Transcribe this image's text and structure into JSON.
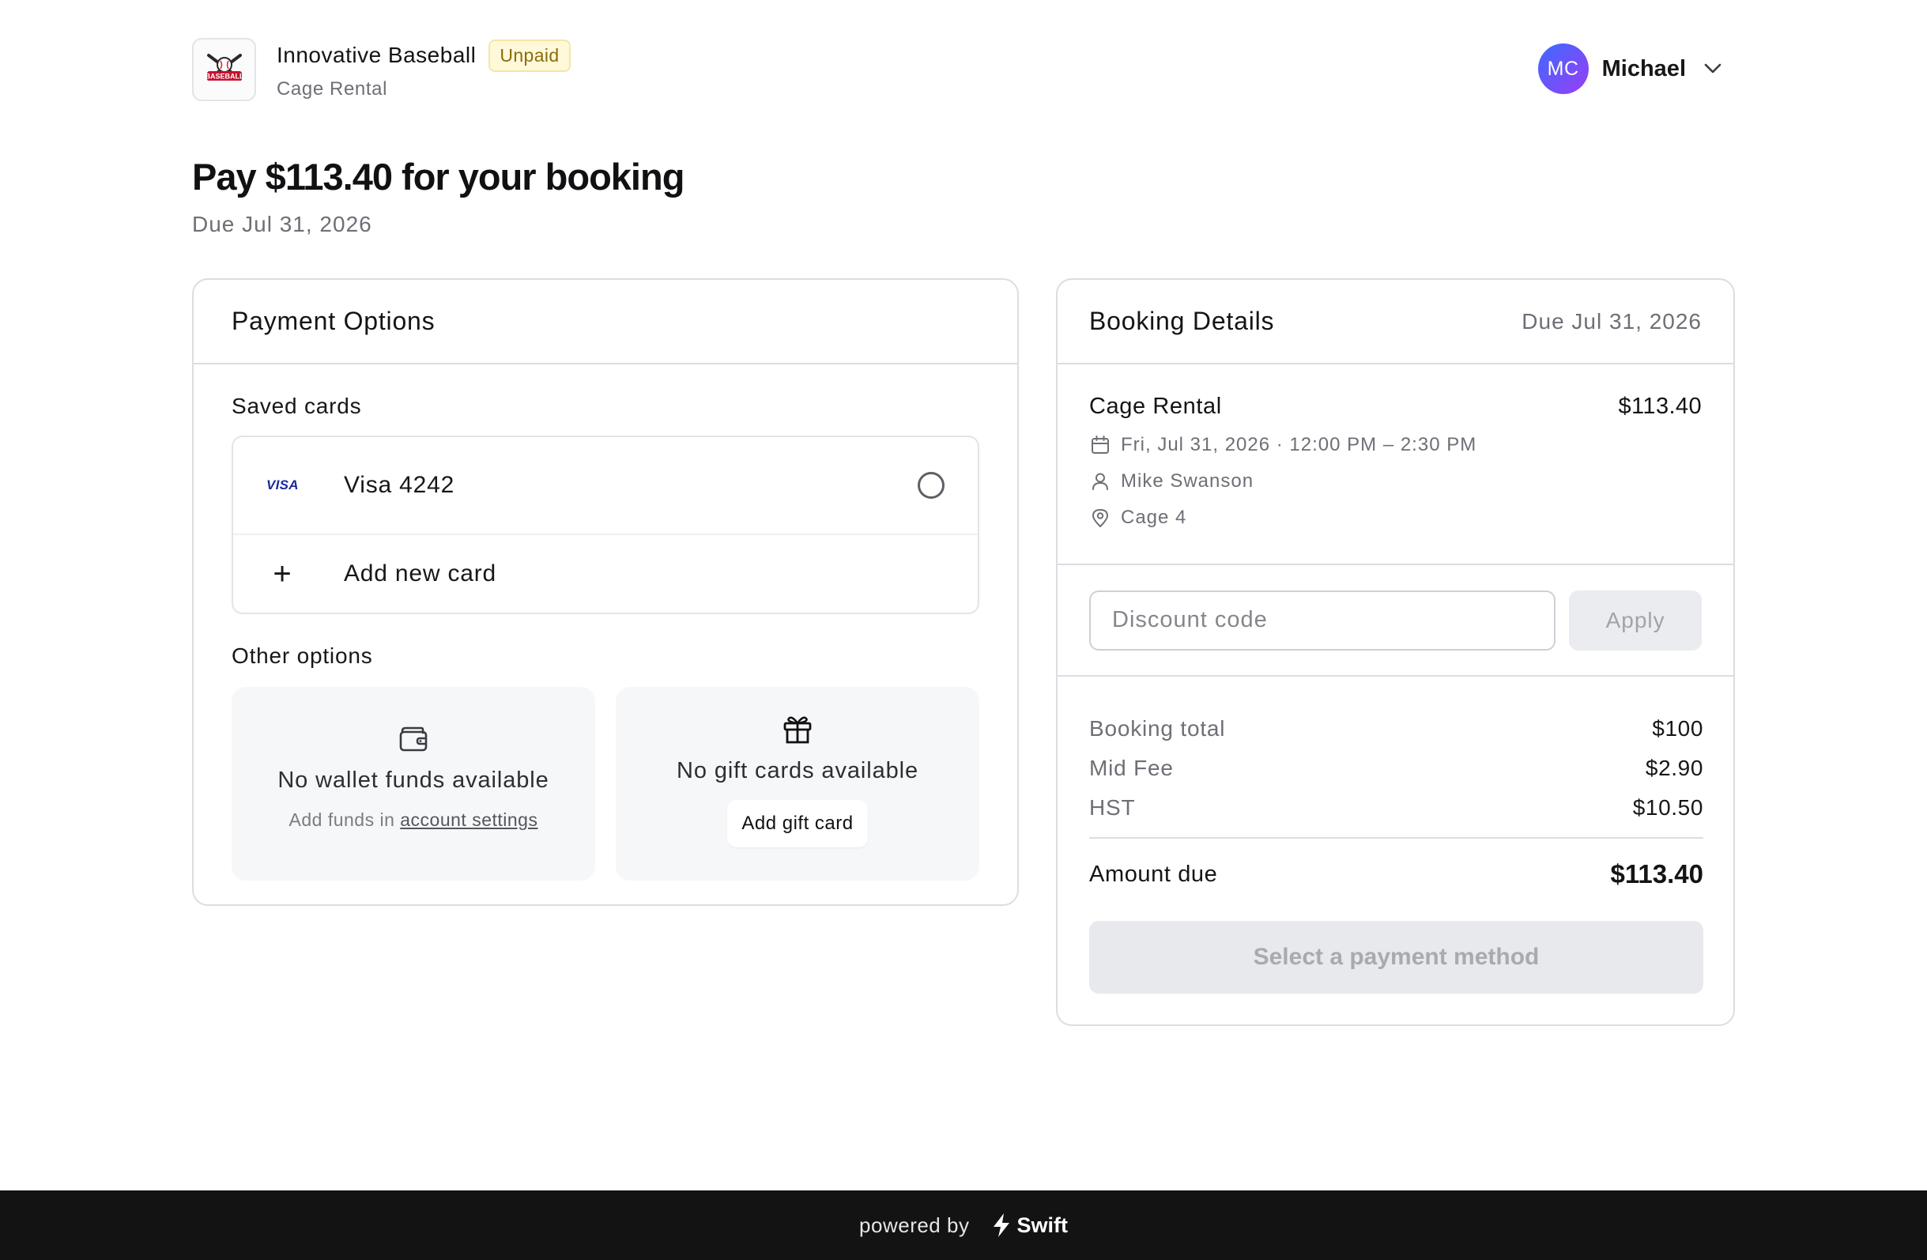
{
  "header": {
    "org_name": "Innovative Baseball",
    "status": "Unpaid",
    "subtitle": "Cage Rental",
    "logo_text": "BASEBALL"
  },
  "user": {
    "initials": "MC",
    "name": "Michael"
  },
  "main": {
    "title": "Pay $113.40 for your booking",
    "due": "Due Jul 31, 2026"
  },
  "payment": {
    "title": "Payment Options",
    "saved_cards_label": "Saved cards",
    "saved_cards": [
      {
        "brand": "VISA",
        "label": "Visa 4242"
      }
    ],
    "add_card_label": "Add new card",
    "other_label": "Other options",
    "wallet": {
      "title": "No wallet funds available",
      "sub_prefix": "Add funds in",
      "link": "account settings"
    },
    "gift": {
      "title": "No gift cards available",
      "button": "Add gift card"
    }
  },
  "booking": {
    "title": "Booking Details",
    "due": "Due Jul 31, 2026",
    "item": {
      "name": "Cage Rental",
      "price": "$113.40",
      "datetime": "Fri, Jul 31, 2026 · 12:00 PM – 2:30 PM",
      "person": "Mike Swanson",
      "location": "Cage 4"
    },
    "discount": {
      "placeholder": "Discount code",
      "button": "Apply"
    },
    "totals": [
      {
        "label": "Booking total",
        "value": "$100"
      },
      {
        "label": "Mid Fee",
        "value": "$2.90"
      },
      {
        "label": "HST",
        "value": "$10.50"
      }
    ],
    "amount_due_label": "Amount due",
    "amount_due_value": "$113.40",
    "pay_button": "Select a payment method"
  },
  "footer": {
    "powered_by": "powered by",
    "brand": "Swift"
  },
  "colors": {
    "badge_bg": "#fff8d9",
    "badge_text": "#8a6d0b",
    "avatar_start": "#3b6bff",
    "avatar_end": "#9a3df5",
    "footer_bg": "#131313"
  }
}
